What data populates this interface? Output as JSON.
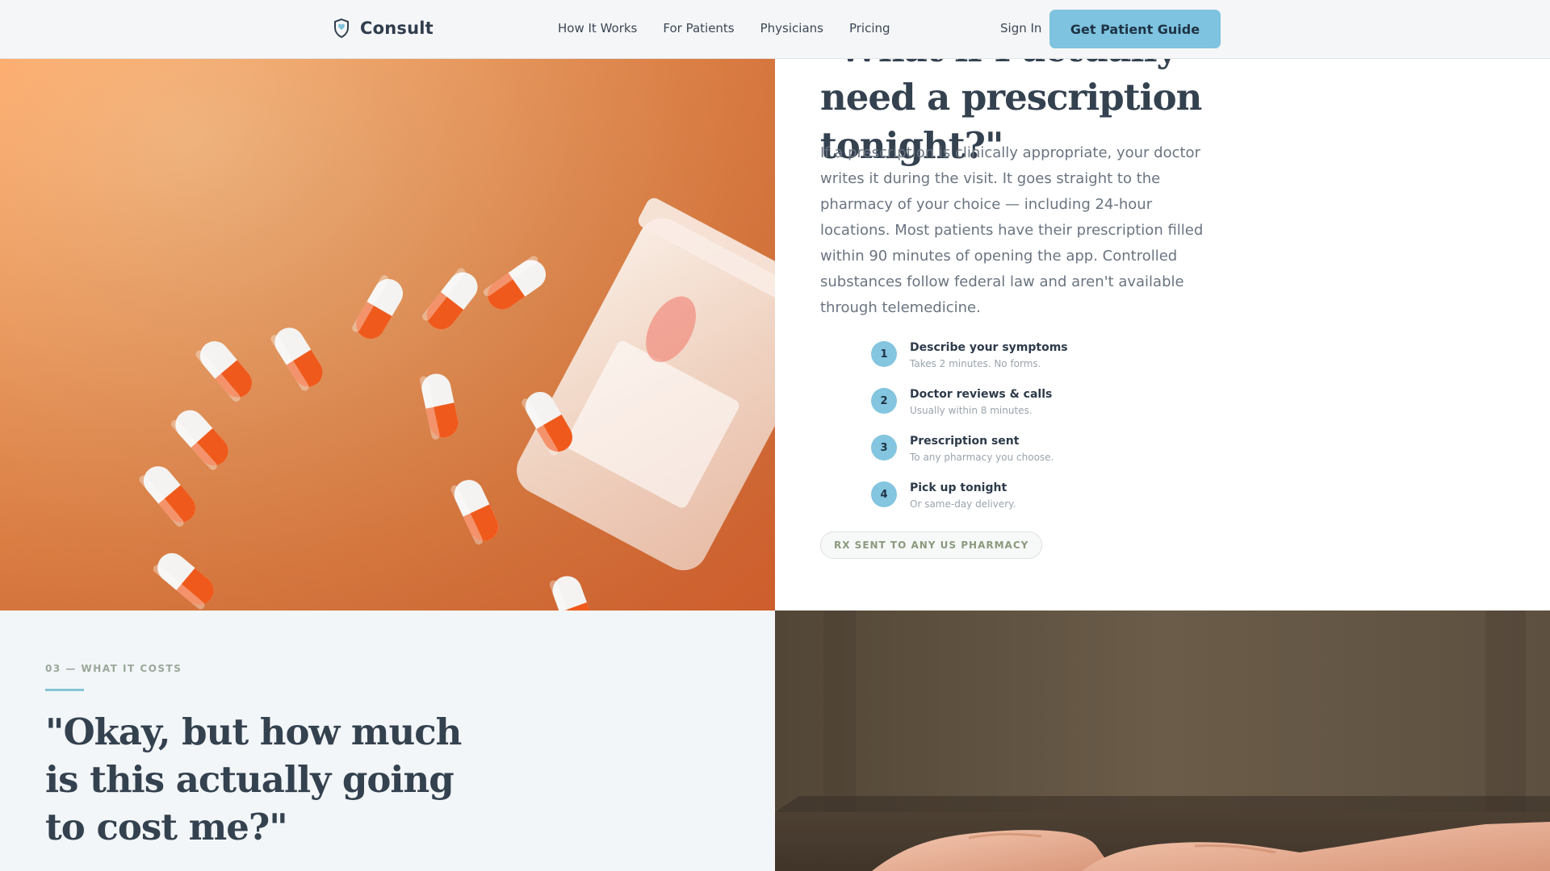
{
  "nav": {
    "brand": "Consult",
    "links": [
      "How It Works",
      "For Patients",
      "Physicians",
      "Pricing"
    ],
    "sign_in": "Sign In",
    "cta": "Get Patient Guide"
  },
  "prescription": {
    "title": "\"What if I actually need a prescription tonight?\"",
    "body": "If a prescription is clinically appropriate, your doctor writes it during the visit. It goes straight to the pharmacy of your choice — including 24-hour locations. Most patients have their prescription filled within 90 minutes of opening the app. Controlled substances follow federal law and aren't available through telemedicine.",
    "steps": [
      {
        "num": "1",
        "title": "Describe your symptoms",
        "sub": "Takes 2 minutes. No forms."
      },
      {
        "num": "2",
        "title": "Doctor reviews & calls",
        "sub": "Usually within 8 minutes."
      },
      {
        "num": "3",
        "title": "Prescription sent",
        "sub": "To any pharmacy you choose."
      },
      {
        "num": "4",
        "title": "Pick up tonight",
        "sub": "Or same-day delivery."
      }
    ],
    "badge": "RX SENT TO ANY US PHARMACY"
  },
  "cost": {
    "eyebrow": "03 — WHAT IT COSTS",
    "title": "\"Okay, but how much is this actually going to cost me?\""
  },
  "colors": {
    "accent": "#7ec3df",
    "heading": "#34414f",
    "body_text": "#6a7480",
    "pill_orange": "#ef5a1c",
    "background_orange": "#fca96a"
  },
  "icons": {
    "brand": "heart-shield-icon"
  }
}
